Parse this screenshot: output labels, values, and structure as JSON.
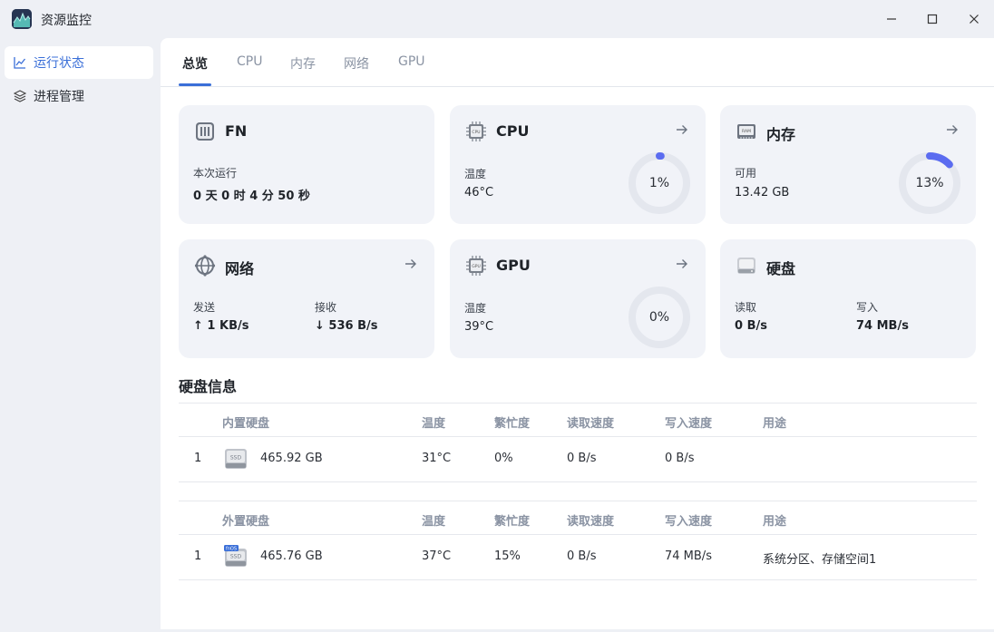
{
  "window": {
    "title": "资源监控"
  },
  "sidebar": {
    "items": [
      {
        "label": "运行状态",
        "icon": "chart-line-icon",
        "active": true
      },
      {
        "label": "进程管理",
        "icon": "layers-icon",
        "active": false
      }
    ]
  },
  "tabs": [
    {
      "label": "总览",
      "active": true
    },
    {
      "label": "CPU"
    },
    {
      "label": "内存"
    },
    {
      "label": "网络"
    },
    {
      "label": "GPU"
    }
  ],
  "cards": {
    "fn": {
      "title": "FN",
      "label": "本次运行",
      "value": "0 天 0 时 4 分 50 秒"
    },
    "cpu": {
      "title": "CPU",
      "label": "温度",
      "value": "46°C",
      "gauge_text": "1%",
      "gauge_fraction": 0.01
    },
    "memory": {
      "title": "内存",
      "label": "可用",
      "value": "13.42 GB",
      "gauge_text": "13%",
      "gauge_fraction": 0.13
    },
    "network": {
      "title": "网络",
      "send_label": "发送",
      "send_value": "↑ 1 KB/s",
      "recv_label": "接收",
      "recv_value": "↓ 536 B/s"
    },
    "gpu": {
      "title": "GPU",
      "label": "温度",
      "value": "39°C",
      "gauge_text": "0%",
      "gauge_fraction": 0
    },
    "disk": {
      "title": "硬盘",
      "read_label": "读取",
      "read_value": "0 B/s",
      "write_label": "写入",
      "write_value": "74 MB/s"
    }
  },
  "disk_info": {
    "title": "硬盘信息",
    "internal": {
      "headers": [
        "内置硬盘",
        "温度",
        "繁忙度",
        "读取速度",
        "写入速度",
        "用途"
      ],
      "rows": [
        {
          "index": "1",
          "size": "465.92 GB",
          "temp": "31°C",
          "busy": "0%",
          "read": "0 B/s",
          "write": "0 B/s",
          "usage": ""
        }
      ]
    },
    "external": {
      "headers": [
        "外置硬盘",
        "温度",
        "繁忙度",
        "读取速度",
        "写入速度",
        "用途"
      ],
      "rows": [
        {
          "index": "1",
          "size": "465.76 GB",
          "temp": "37°C",
          "busy": "15%",
          "read": "0 B/s",
          "write": "74 MB/s",
          "usage": "系统分区、存储空间1",
          "badge": "fnOS"
        }
      ]
    },
    "disk_badge": "SSD"
  },
  "colors": {
    "accent": "#3a6fd8",
    "gauge_fill": "#5b6cf0",
    "gauge_track": "#e4e7ee"
  }
}
